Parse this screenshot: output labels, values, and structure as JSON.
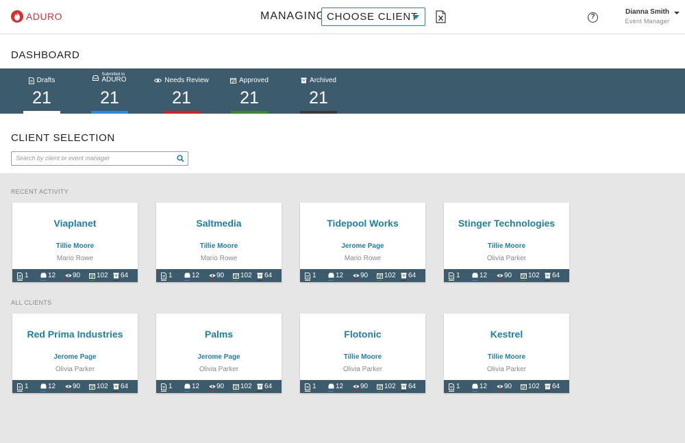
{
  "header": {
    "logo_text": "ADURO",
    "managing_label": "MANAGING",
    "client_select_label": "CHOOSE CLIENT",
    "user_name": "Dianna Smith",
    "user_role": "Event Manager",
    "help_icon_glyph": "?"
  },
  "dashboard": {
    "title": "DASHBOARD",
    "stats": [
      {
        "label": "Drafts",
        "count": "21",
        "color": "#ffffff",
        "icon": "document-icon"
      },
      {
        "label_small": "Submitted to",
        "label": "ADURO",
        "count": "21",
        "color": "#2f8be0",
        "icon": "inbox-icon"
      },
      {
        "label": "Needs Review",
        "count": "21",
        "color": "#c8272b",
        "icon": "eye-icon"
      },
      {
        "label": "Approved",
        "count": "21",
        "color": "#3b8a2a",
        "icon": "calendar-check-icon"
      },
      {
        "label": "Archived",
        "count": "21",
        "color": "#3a3a3a",
        "icon": "archive-icon"
      }
    ]
  },
  "client_selection": {
    "title": "CLIENT SELECTION",
    "search_placeholder": "Search by client or event manager"
  },
  "recent_activity": {
    "label": "RECENT ACTIVITY",
    "cards": [
      {
        "name": "Viaplanet",
        "manager": "Tillie Moore",
        "contact": "Mario Rowe"
      },
      {
        "name": "Saltmedia",
        "manager": "Tillie Moore",
        "contact": "Mario Rowe"
      },
      {
        "name": "Tidepool Works",
        "manager": "Jerome Page",
        "contact": "Mario Rowe"
      },
      {
        "name": "Stinger Technologies",
        "manager": "Tillie Moore",
        "contact": "Olivia Parker"
      }
    ]
  },
  "all_clients": {
    "label": "ALL CLIENTS",
    "cards": [
      {
        "name": "Red Prima Industries",
        "manager": "Jerome Page",
        "contact": "Olivia Parker"
      },
      {
        "name": "Palms",
        "manager": "Jerome Page",
        "contact": "Olivia Parker"
      },
      {
        "name": "Flotonic",
        "manager": "Tillie Moore",
        "contact": "Olivia Parker"
      },
      {
        "name": "Kestrel",
        "manager": "Tillie Moore",
        "contact": "Olivia Parker"
      }
    ]
  },
  "card_counts": {
    "drafts": "1",
    "submitted": "12",
    "review": "90",
    "approved": "102",
    "archived": "64"
  }
}
